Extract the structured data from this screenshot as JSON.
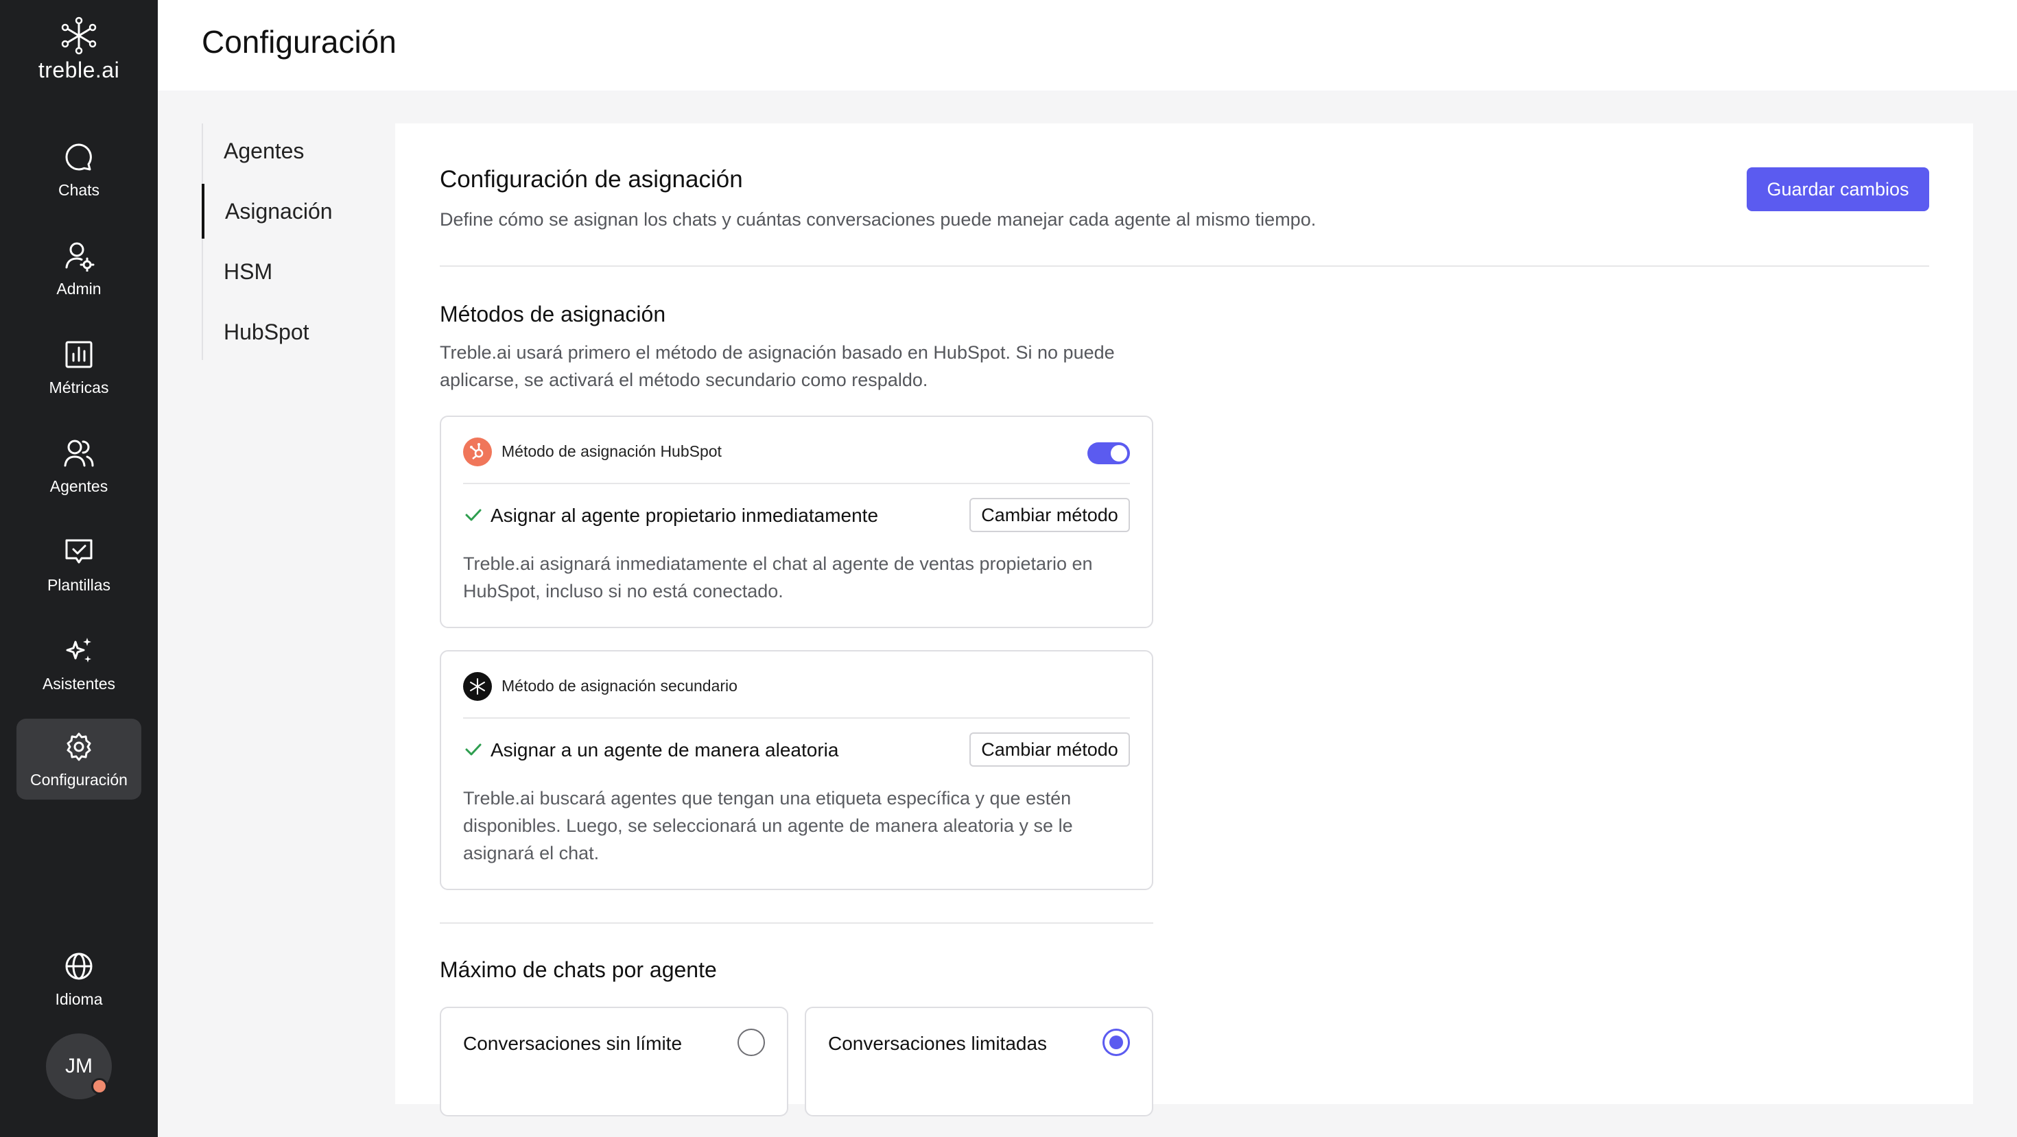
{
  "app": {
    "brand": "treble.ai",
    "page_title": "Configuración"
  },
  "sidebar": {
    "items": [
      {
        "label": "Chats",
        "icon": "chat-bubble-icon"
      },
      {
        "label": "Admin",
        "icon": "user-gear-icon"
      },
      {
        "label": "Métricas",
        "icon": "bar-chart-icon"
      },
      {
        "label": "Agentes",
        "icon": "users-icon"
      },
      {
        "label": "Plantillas",
        "icon": "template-check-icon"
      },
      {
        "label": "Asistentes",
        "icon": "sparkles-icon"
      },
      {
        "label": "Configuración",
        "icon": "gear-icon",
        "active": true
      }
    ],
    "language_label": "Idioma",
    "avatar_initials": "JM"
  },
  "subnav": {
    "items": [
      "Agentes",
      "Asignación",
      "HSM",
      "HubSpot"
    ],
    "active": "Asignación"
  },
  "assignment": {
    "title": "Configuración de asignación",
    "description": "Define cómo se asignan los chats y cuántas conversaciones puede manejar cada agente al mismo tiempo.",
    "save_label": "Guardar cambios",
    "methods_title": "Métodos de asignación",
    "methods_description_line1": "Treble.ai usará primero el método de asignación basado en HubSpot. Si no puede",
    "methods_description_line2": "aplicarse, se activará el método secundario como respaldo.",
    "hubspot_method": {
      "title": "Método de asignación HubSpot",
      "enabled": true,
      "choice": "Asignar al agente propietario inmediatamente",
      "change_label": "Cambiar método",
      "desc_line1": "Treble.ai asignará inmediatamente el chat al agente de ventas propietario en",
      "desc_line2": "HubSpot, incluso si no está conectado."
    },
    "secondary_method": {
      "title": "Método de asignación secundario",
      "choice": "Asignar a un agente de manera aleatoria",
      "change_label": "Cambiar método",
      "desc_line1": "Treble.ai buscará agentes que tengan una etiqueta específica y que estén",
      "desc_line2": "disponibles. Luego, se seleccionará un agente de manera aleatoria y se le",
      "desc_line3": "asignará el chat."
    },
    "max_title": "Máximo de chats por agente",
    "max_options": [
      {
        "label": "Conversaciones sin límite",
        "selected": false
      },
      {
        "label": "Conversaciones limitadas",
        "selected": true
      }
    ]
  },
  "colors": {
    "accent": "#5b5bf0",
    "sidebar_bg": "#1e1f21",
    "hubspot_orange": "#f0765a",
    "check_green": "#2e9e4f"
  }
}
